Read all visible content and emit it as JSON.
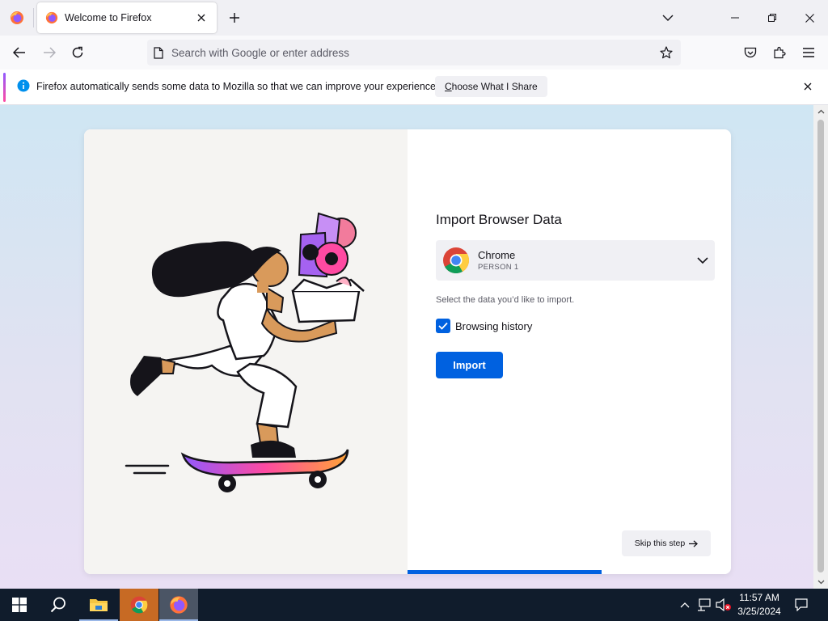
{
  "tabbar": {
    "firefox_view_icon": "firefox-logo",
    "tab_title": "Welcome to Firefox",
    "new_tab_icon": "plus",
    "list_tabs_icon": "chevron-down"
  },
  "window_controls": {
    "minimize_icon": "minimize",
    "restore_icon": "restore",
    "close_icon": "close"
  },
  "navbar": {
    "url_placeholder": "Search with Google or enter address",
    "url_value": ""
  },
  "notification": {
    "message": "Firefox automatically sends some data to Mozilla so that we can improve your experience.",
    "button_label": "Choose What I Share",
    "button_accesskey": "C",
    "button_rest": "hoose What I Share"
  },
  "import": {
    "title": "Import Browser Data",
    "browser_name": "Chrome",
    "browser_profile": "PERSON 1",
    "hint": "Select the data you’d like to import.",
    "checkbox_label": "Browsing history",
    "checkbox_checked": true,
    "import_label": "Import",
    "skip_label": "Skip this step",
    "skip_arrow": "→",
    "progress": 0.6
  },
  "taskbar": {
    "items": [
      "start",
      "search",
      "file-explorer",
      "chrome",
      "firefox"
    ],
    "active_item": "chrome",
    "time": "11:57 AM",
    "date": "3/25/2024"
  },
  "colors": {
    "accent": "#0061e0",
    "taskbar": "#101c2c",
    "content_top": "#cfe6f3",
    "content_bottom": "#e9dff4"
  }
}
